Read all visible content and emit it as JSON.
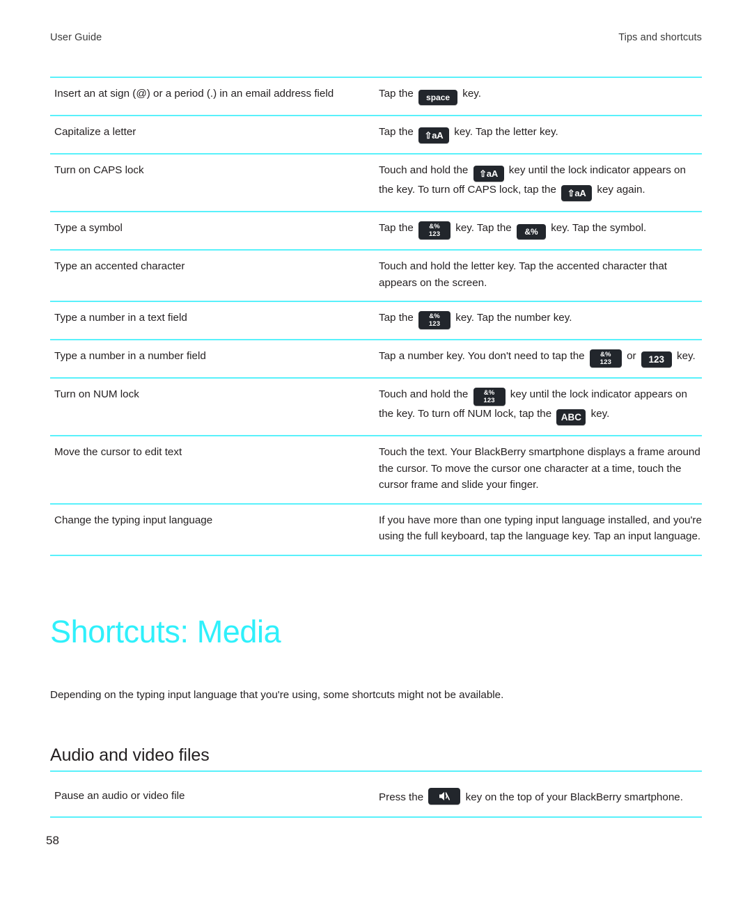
{
  "header": {
    "left": "User Guide",
    "right": "Tips and shortcuts"
  },
  "colors": {
    "rule": "#59f1fb",
    "heading_accent": "#2ff0fb",
    "key_chip_bg": "#22262c",
    "text": "#231f20"
  },
  "keys": {
    "space": {
      "label": "space",
      "name": "space-key-icon"
    },
    "shift": {
      "label": "⇧aA",
      "name": "shift-key-icon"
    },
    "symnum": {
      "line1": "&%",
      "line2": "123",
      "name": "symbol-number-key-icon"
    },
    "sym": {
      "label": "&%",
      "name": "symbol-key-icon"
    },
    "num": {
      "label": "123",
      "name": "number-key-icon"
    },
    "abc": {
      "label": "ABC",
      "name": "alpha-key-icon"
    },
    "mute": {
      "label": "mute",
      "name": "mute-key-icon"
    }
  },
  "typing_table": {
    "rows": [
      {
        "task": "Insert an at sign (@) or a period (.) in an email address field",
        "action_parts": [
          {
            "type": "text",
            "value": "Tap the "
          },
          {
            "type": "key",
            "key": "space"
          },
          {
            "type": "text",
            "value": " key."
          }
        ]
      },
      {
        "task": "Capitalize a letter",
        "action_parts": [
          {
            "type": "text",
            "value": "Tap the "
          },
          {
            "type": "key",
            "key": "shift"
          },
          {
            "type": "text",
            "value": " key. Tap the letter key."
          }
        ]
      },
      {
        "task": "Turn on CAPS lock",
        "action_parts": [
          {
            "type": "text",
            "value": "Touch and hold the "
          },
          {
            "type": "key",
            "key": "shift"
          },
          {
            "type": "text",
            "value": " key until the lock indicator appears on the key. To turn off CAPS lock, tap the "
          },
          {
            "type": "key",
            "key": "shift"
          },
          {
            "type": "text",
            "value": " key again."
          }
        ]
      },
      {
        "task": "Type a symbol",
        "action_parts": [
          {
            "type": "text",
            "value": "Tap the "
          },
          {
            "type": "key",
            "key": "symnum"
          },
          {
            "type": "text",
            "value": " key. Tap the "
          },
          {
            "type": "key",
            "key": "sym"
          },
          {
            "type": "text",
            "value": " key. Tap the symbol."
          }
        ]
      },
      {
        "task": "Type an accented character",
        "action_parts": [
          {
            "type": "text",
            "value": "Touch and hold the letter key. Tap the accented character that appears on the screen."
          }
        ]
      },
      {
        "task": "Type a number in a text field",
        "action_parts": [
          {
            "type": "text",
            "value": "Tap the "
          },
          {
            "type": "key",
            "key": "symnum"
          },
          {
            "type": "text",
            "value": " key. Tap the number key."
          }
        ]
      },
      {
        "task": "Type a number in a number field",
        "action_parts": [
          {
            "type": "text",
            "value": "Tap a number key. You don't need to tap the "
          },
          {
            "type": "key",
            "key": "symnum"
          },
          {
            "type": "text",
            "value": " or "
          },
          {
            "type": "key",
            "key": "num"
          },
          {
            "type": "text",
            "value": " key."
          }
        ]
      },
      {
        "task": "Turn on NUM lock",
        "action_parts": [
          {
            "type": "text",
            "value": "Touch and hold the "
          },
          {
            "type": "key",
            "key": "symnum"
          },
          {
            "type": "text",
            "value": " key until the lock indicator appears on the key. To turn off NUM lock, tap the "
          },
          {
            "type": "key",
            "key": "abc"
          },
          {
            "type": "text",
            "value": " key."
          }
        ]
      },
      {
        "task": "Move the cursor to edit text",
        "action_parts": [
          {
            "type": "text",
            "value": "Touch the text. Your BlackBerry smartphone displays a frame around the cursor. To move the cursor one character at a time, touch the cursor frame and slide your finger."
          }
        ]
      },
      {
        "task": "Change the typing input language",
        "action_parts": [
          {
            "type": "text",
            "value": "If you have more than one typing input language installed, and you're using the full keyboard, tap the language key. Tap an input language."
          }
        ]
      }
    ]
  },
  "media_section": {
    "title": "Shortcuts: Media",
    "intro": "Depending on the typing input language that you're using, some shortcuts might not be available.",
    "subheading": "Audio and video files",
    "rows": [
      {
        "task": "Pause an audio or video file",
        "action_parts": [
          {
            "type": "text",
            "value": "Press the "
          },
          {
            "type": "key",
            "key": "mute"
          },
          {
            "type": "text",
            "value": " key on the top of your BlackBerry smartphone."
          }
        ]
      }
    ]
  },
  "footer": {
    "page_number": "58"
  }
}
